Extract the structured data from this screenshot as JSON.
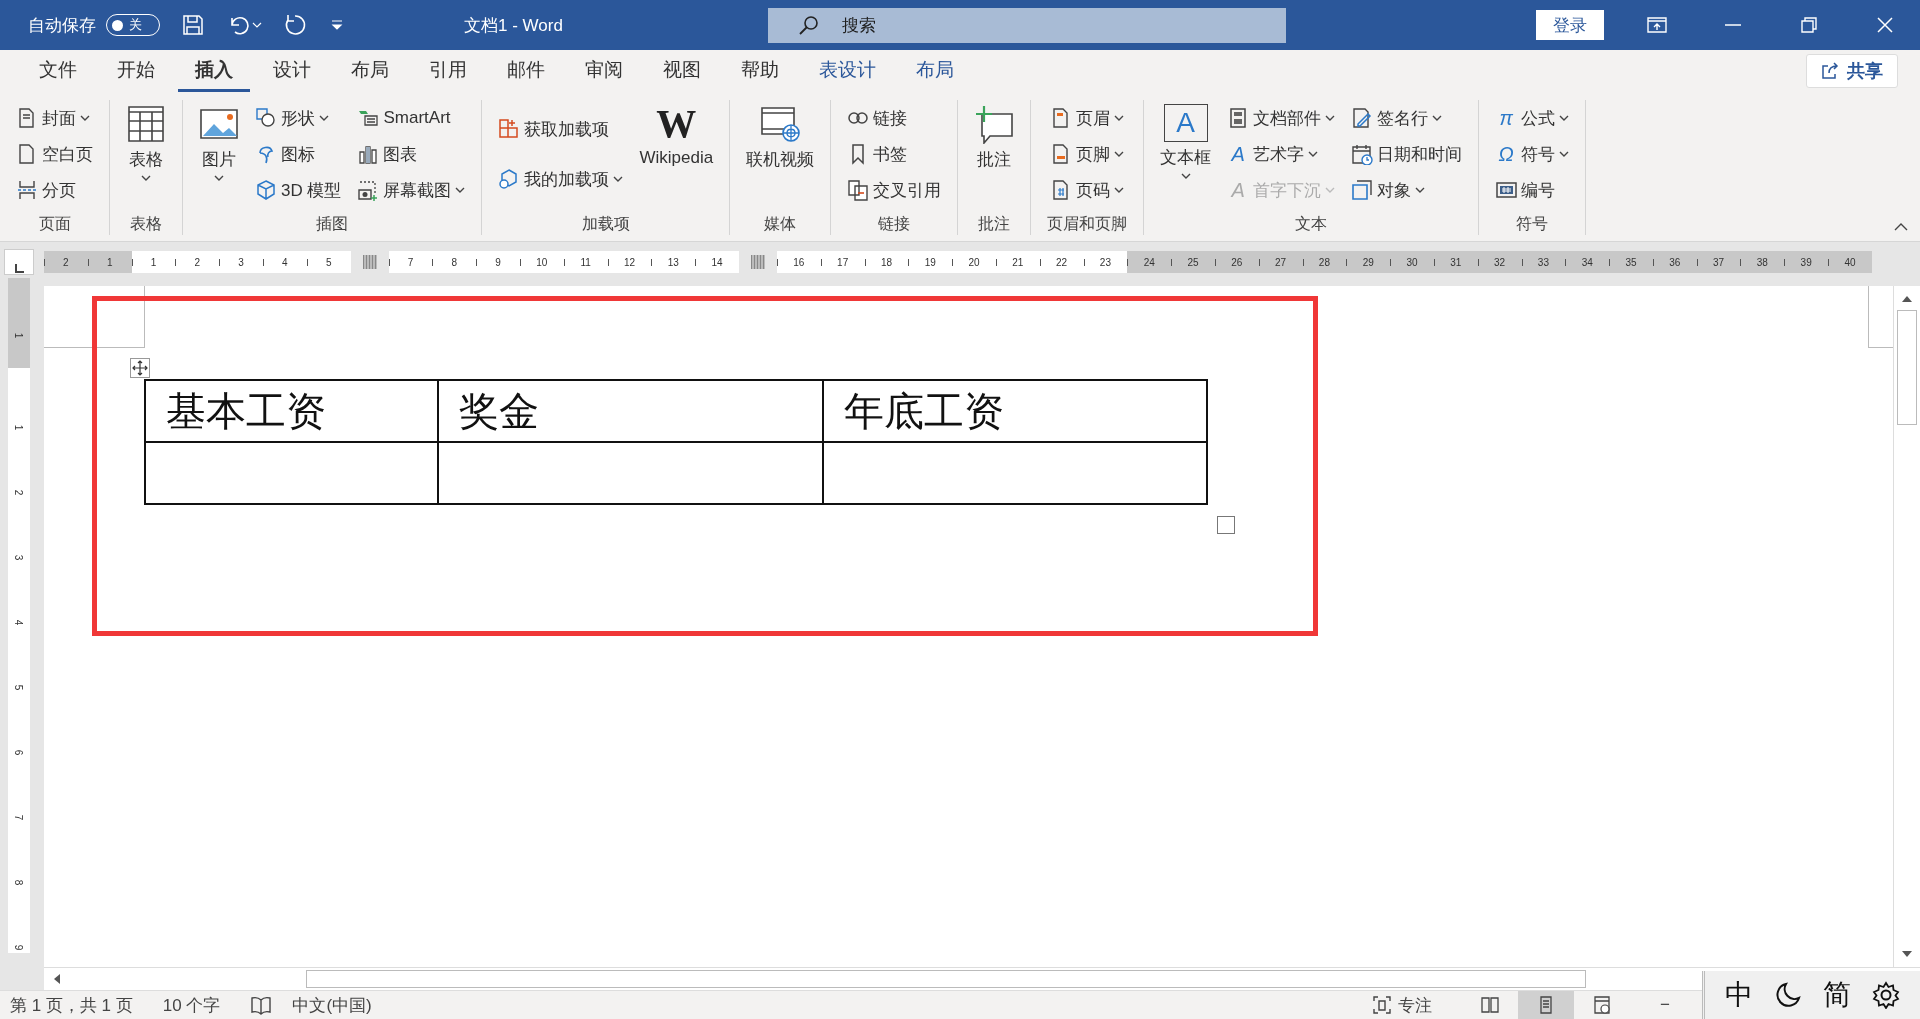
{
  "title_bar": {
    "autosave_label": "自动保存",
    "autosave_toggle": {
      "on": false,
      "label": "关"
    },
    "title": "文档1  -  Word",
    "search": {
      "placeholder": "搜索"
    },
    "sign_in": "登录"
  },
  "tabs": [
    {
      "label": "文件",
      "selected": false,
      "kind": "normal"
    },
    {
      "label": "开始",
      "selected": false,
      "kind": "normal"
    },
    {
      "label": "插入",
      "selected": true,
      "kind": "normal"
    },
    {
      "label": "设计",
      "selected": false,
      "kind": "normal"
    },
    {
      "label": "布局",
      "selected": false,
      "kind": "normal"
    },
    {
      "label": "引用",
      "selected": false,
      "kind": "normal"
    },
    {
      "label": "邮件",
      "selected": false,
      "kind": "normal"
    },
    {
      "label": "审阅",
      "selected": false,
      "kind": "normal"
    },
    {
      "label": "视图",
      "selected": false,
      "kind": "normal"
    },
    {
      "label": "帮助",
      "selected": false,
      "kind": "normal"
    },
    {
      "label": "表设计",
      "selected": false,
      "kind": "contextual"
    },
    {
      "label": "布局",
      "selected": false,
      "kind": "contextual"
    }
  ],
  "share_button": "共享",
  "ribbon": [
    {
      "label": "页面",
      "columns": [
        {
          "kind": "stack",
          "items": [
            {
              "label": "封面",
              "dropdown": true,
              "disabled": false
            },
            {
              "label": "空白页",
              "dropdown": false,
              "disabled": false
            },
            {
              "label": "分页",
              "dropdown": false,
              "disabled": false
            }
          ]
        }
      ]
    },
    {
      "label": "表格",
      "columns": [
        {
          "kind": "large",
          "items": [
            {
              "label": "表格",
              "dropdown": true,
              "disabled": false
            }
          ]
        }
      ]
    },
    {
      "label": "插图",
      "columns": [
        {
          "kind": "large",
          "items": [
            {
              "label": "图片",
              "dropdown": true,
              "disabled": false
            }
          ]
        },
        {
          "kind": "stack",
          "items": [
            {
              "label": "形状",
              "dropdown": true,
              "disabled": false
            },
            {
              "label": "图标",
              "dropdown": false,
              "disabled": false
            },
            {
              "label": "3D 模型",
              "dropdown": false,
              "disabled": false
            }
          ]
        },
        {
          "kind": "stack",
          "items": [
            {
              "label": "SmartArt",
              "dropdown": false,
              "disabled": false
            },
            {
              "label": "图表",
              "dropdown": false,
              "disabled": false
            },
            {
              "label": "屏幕截图",
              "dropdown": true,
              "disabled": false
            }
          ]
        }
      ]
    },
    {
      "label": "加载项",
      "columns": [
        {
          "kind": "stack",
          "items": [
            {
              "label": "获取加载项",
              "dropdown": false,
              "disabled": false
            },
            {
              "label": "我的加载项",
              "dropdown": true,
              "disabled": false
            }
          ]
        },
        {
          "kind": "large",
          "items": [
            {
              "label": "Wikipedia",
              "dropdown": false,
              "disabled": false,
              "icon_text": "W"
            }
          ]
        }
      ]
    },
    {
      "label": "媒体",
      "columns": [
        {
          "kind": "large",
          "items": [
            {
              "label": "联机视频",
              "dropdown": false,
              "disabled": false
            }
          ]
        }
      ]
    },
    {
      "label": "链接",
      "columns": [
        {
          "kind": "stack",
          "items": [
            {
              "label": "链接",
              "dropdown": false,
              "disabled": false
            },
            {
              "label": "书签",
              "dropdown": false,
              "disabled": false
            },
            {
              "label": "交叉引用",
              "dropdown": false,
              "disabled": false
            }
          ]
        }
      ]
    },
    {
      "label": "批注",
      "columns": [
        {
          "kind": "large",
          "items": [
            {
              "label": "批注",
              "dropdown": false,
              "disabled": false
            }
          ]
        }
      ]
    },
    {
      "label": "页眉和页脚",
      "columns": [
        {
          "kind": "stack",
          "items": [
            {
              "label": "页眉",
              "dropdown": true,
              "disabled": false
            },
            {
              "label": "页脚",
              "dropdown": true,
              "disabled": false
            },
            {
              "label": "页码",
              "dropdown": true,
              "disabled": false
            }
          ]
        }
      ]
    },
    {
      "label": "文本",
      "columns": [
        {
          "kind": "large",
          "items": [
            {
              "label": "文本框",
              "dropdown": true,
              "disabled": false,
              "icon_text": "A"
            }
          ]
        },
        {
          "kind": "stack",
          "items": [
            {
              "label": "文档部件",
              "dropdown": true,
              "disabled": false
            },
            {
              "label": "艺术字",
              "dropdown": true,
              "disabled": false,
              "icon_text": "A"
            },
            {
              "label": "首字下沉",
              "dropdown": true,
              "disabled": true,
              "icon_text": "A"
            }
          ]
        },
        {
          "kind": "stack",
          "items": [
            {
              "label": "签名行",
              "dropdown": true,
              "disabled": false
            },
            {
              "label": "日期和时间",
              "dropdown": false,
              "disabled": false
            },
            {
              "label": "对象",
              "dropdown": true,
              "disabled": false
            }
          ]
        }
      ]
    },
    {
      "label": "符号",
      "columns": [
        {
          "kind": "stack",
          "items": [
            {
              "label": "公式",
              "dropdown": true,
              "disabled": false,
              "icon_text": "π"
            },
            {
              "label": "符号",
              "dropdown": true,
              "disabled": false,
              "icon_text": "Ω"
            },
            {
              "label": "编号",
              "dropdown": false,
              "disabled": false
            }
          ]
        }
      ]
    }
  ],
  "horizontal_ruler": [
    {
      "kind": "margin",
      "labels": [
        "2",
        "1"
      ]
    },
    {
      "kind": "text",
      "labels": [
        "1",
        "2",
        "3",
        "4",
        "5"
      ]
    },
    {
      "kind": "column_marker"
    },
    {
      "kind": "text",
      "labels": [
        "7",
        "8",
        "9",
        "10",
        "11",
        "12",
        "13",
        "14"
      ]
    },
    {
      "kind": "column_marker"
    },
    {
      "kind": "text",
      "labels": [
        "16",
        "17",
        "18",
        "19",
        "20",
        "21",
        "22",
        "23"
      ]
    },
    {
      "kind": "margin",
      "labels": [
        "24",
        "25",
        "26",
        "27",
        "28",
        "29",
        "30",
        "31",
        "32",
        "33",
        "34",
        "35",
        "36",
        "37",
        "38",
        "39",
        "40"
      ]
    }
  ],
  "vertical_ruler": [
    {
      "kind": "margin",
      "labels": [
        "1"
      ]
    },
    {
      "kind": "text",
      "labels": [
        "1",
        "2",
        "3",
        "4",
        "5",
        "6",
        "7",
        "8",
        "9"
      ]
    }
  ],
  "table": {
    "rows": [
      [
        "基本工资",
        "奖金",
        "年底工资"
      ],
      []
    ]
  },
  "status_bar": {
    "page": "第 1 页，共 1 页",
    "words": "10 个字",
    "language": "中文(中国)",
    "focus": "专注",
    "views": [
      {
        "selected": false
      },
      {
        "selected": true
      },
      {
        "selected": false
      }
    ],
    "zoom_out": "−"
  },
  "ime_bar": {
    "items": [
      {
        "kind": "text",
        "label": "中"
      },
      {
        "kind": "moon"
      },
      {
        "kind": "text",
        "label": "简"
      },
      {
        "kind": "gear"
      }
    ]
  }
}
